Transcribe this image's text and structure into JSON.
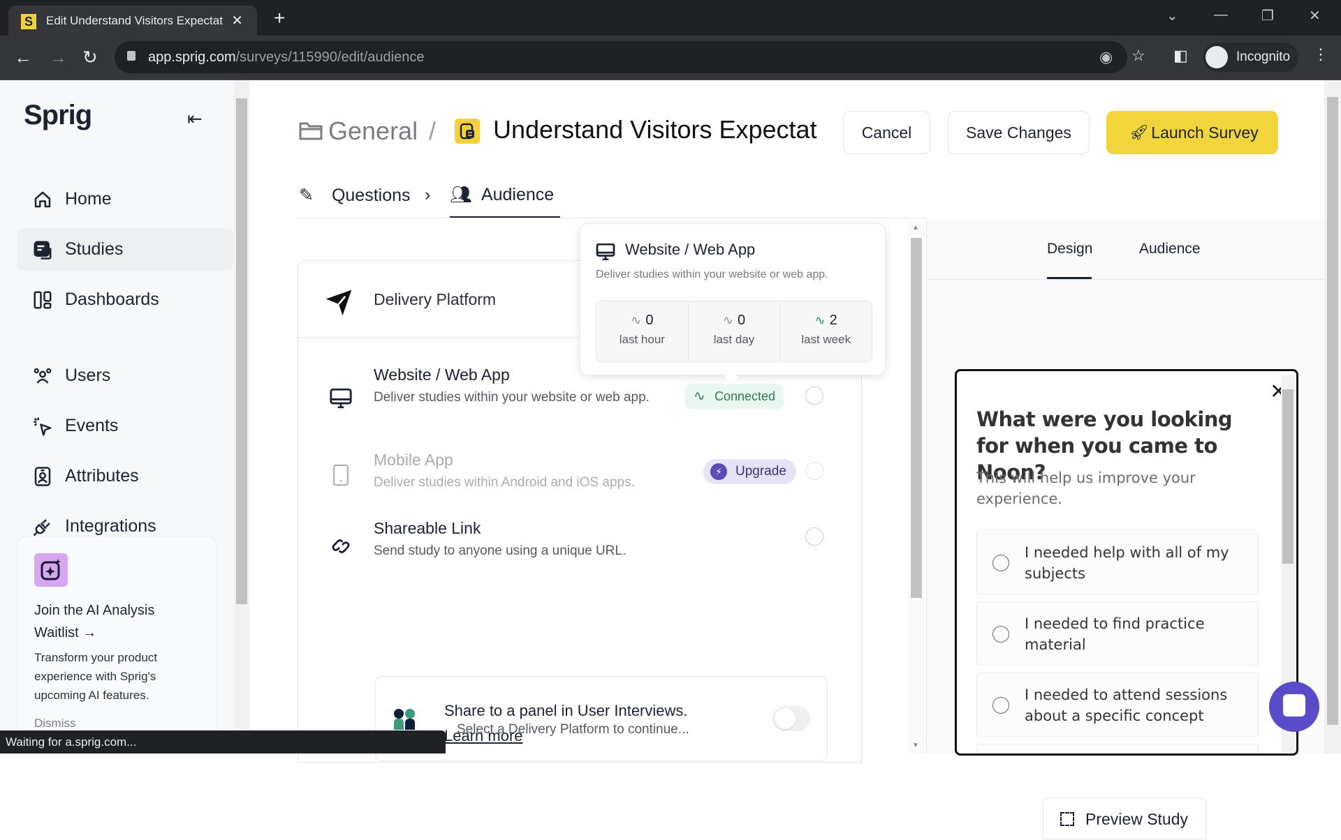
{
  "browser": {
    "tab_title": "Edit Understand Visitors Expectat",
    "tab_favicon": "S",
    "url_host": "app.sprig.com",
    "url_path": "/surveys/115990/edit/audience",
    "profile_label": "Incognito",
    "status_text": "Waiting for a.sprig.com..."
  },
  "sidebar": {
    "logo": "Sprig",
    "items": [
      {
        "label": "Home",
        "icon": "home-icon"
      },
      {
        "label": "Studies",
        "icon": "studies-icon",
        "active": true
      },
      {
        "label": "Dashboards",
        "icon": "dashboards-icon"
      },
      {
        "label": "Users",
        "icon": "users-icon"
      },
      {
        "label": "Events",
        "icon": "events-icon"
      },
      {
        "label": "Attributes",
        "icon": "attributes-icon"
      },
      {
        "label": "Integrations",
        "icon": "integrations-icon"
      }
    ],
    "promo": {
      "title": "Join the AI Analysis Waitlist →",
      "description": "Transform your product experience with Sprig's upcoming AI features.",
      "dismiss": "Dismiss"
    }
  },
  "header": {
    "folder": "General",
    "separator": "/",
    "title": "Understand Visitors Expectat",
    "cancel": "Cancel",
    "save": "Save Changes",
    "launch": "Launch Survey",
    "tabs": [
      {
        "label": "Questions"
      },
      {
        "label": "Audience",
        "active": true
      }
    ]
  },
  "delivery": {
    "title": "Delivery Platform",
    "options": [
      {
        "title": "Website / Web App",
        "description": "Deliver studies within your website or web app.",
        "badge": "Connected"
      },
      {
        "title": "Mobile App",
        "description": "Deliver studies within Android and iOS apps.",
        "badge": "Upgrade",
        "disabled": true
      },
      {
        "title": "Shareable Link",
        "description": "Send study to anyone using a unique URL."
      }
    ],
    "user_interviews": {
      "text": "Share to a panel in User Interviews.",
      "link": "Learn more",
      "enabled": false
    },
    "hint": "Select a Delivery Platform to continue..."
  },
  "popover": {
    "title": "Website / Web App",
    "description": "Deliver studies within your website or web app.",
    "stats": [
      {
        "value": "0",
        "label": "last hour"
      },
      {
        "value": "0",
        "label": "last day"
      },
      {
        "value": "2",
        "label": "last week"
      }
    ]
  },
  "preview": {
    "tabs": [
      {
        "label": "Design",
        "active": true
      },
      {
        "label": "Audience"
      }
    ],
    "question": "What were you looking for when you came to Noon?",
    "subtitle": "This will help us improve your experience.",
    "choices": [
      "I needed help with all of my subjects",
      "I needed to find practice material",
      "I needed to attend sessions about a specific concept"
    ],
    "preview_button": "Preview Study"
  },
  "colors": {
    "accent_yellow": "#f2d53c",
    "connected_green": "#2f7a5b",
    "upgrade_purple": "#5a4bb8",
    "chat_purple": "#5a4bc9"
  }
}
